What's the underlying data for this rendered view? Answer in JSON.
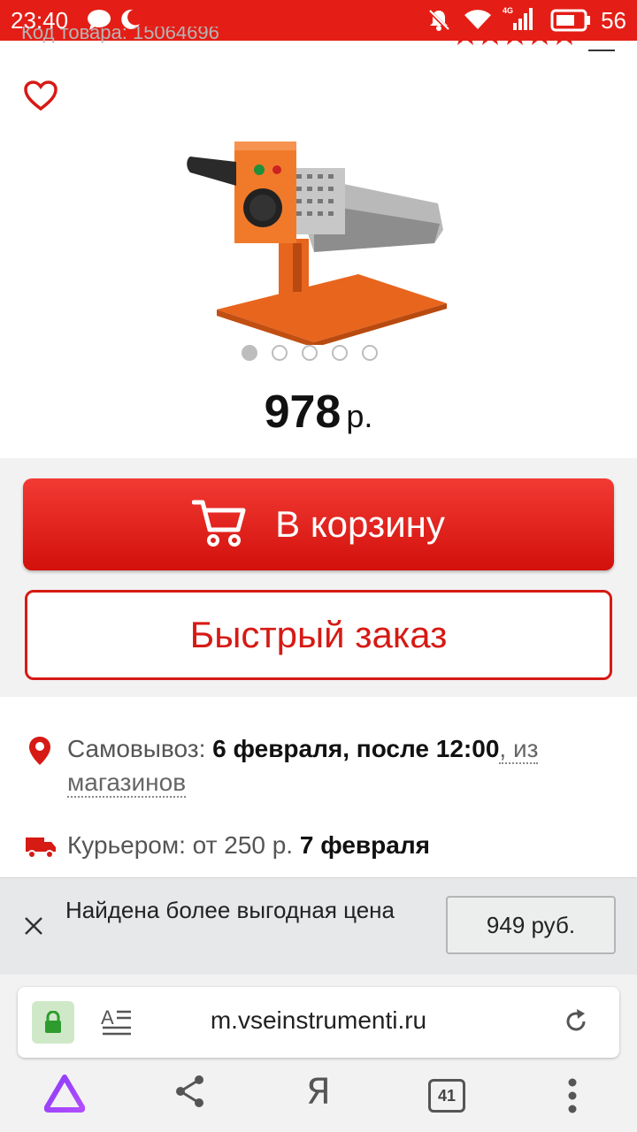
{
  "status_bar": {
    "time": "23:40",
    "network": "4G",
    "battery": "56"
  },
  "header": {
    "product_code": "Код товара: 15064696"
  },
  "product": {
    "image_alt": "Аппарат для сварки полипропиленовых труб",
    "carousel": {
      "count": 5,
      "active": 0
    },
    "price_value": "978",
    "price_currency": "р."
  },
  "actions": {
    "cart_label": "В корзину",
    "quick_order_label": "Быстрый заказ"
  },
  "delivery": {
    "pickup_label": "Самовывоз:",
    "pickup_date": "6 февраля, после 12:00",
    "pickup_from": ", из",
    "pickup_link": "магазинов",
    "courier_label": "Курьером: от 250 р.",
    "courier_date": "7 февраля"
  },
  "better_price": {
    "text": "Найдена более выгодная цена",
    "price": "949 руб."
  },
  "browser": {
    "url": "m.vseinstrumenti.ru",
    "tabs_count": "41",
    "yandex_label": "Я"
  },
  "colors": {
    "brand_red": "#e41e16",
    "button_red": "#d61a14"
  }
}
